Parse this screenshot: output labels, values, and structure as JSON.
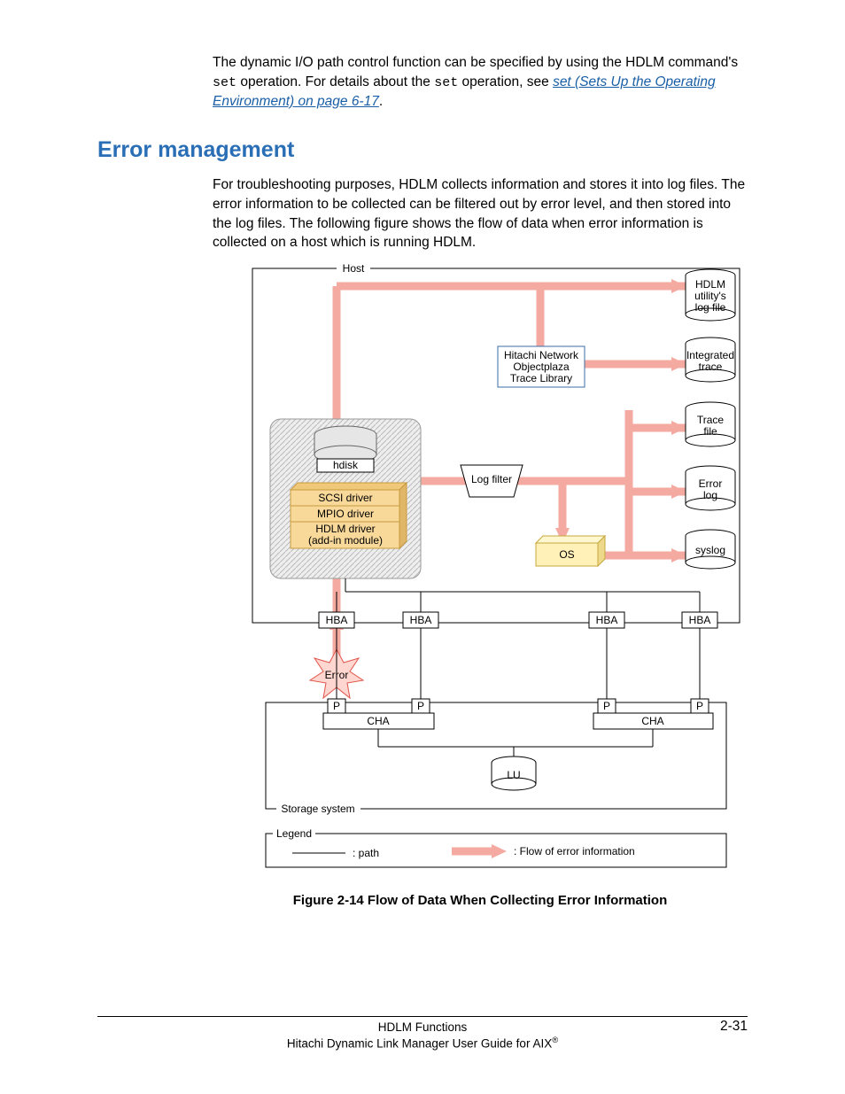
{
  "para1": {
    "t1": "The dynamic I/O path control function can be specified by using the HDLM command's ",
    "code1": "set",
    "t2": " operation. For details about the ",
    "code2": "set",
    "t3": " operation, see ",
    "link": "set (Sets Up the Operating Environment) on page 6-17",
    "t4": "."
  },
  "heading": "Error management",
  "para2": "For troubleshooting purposes, HDLM collects information and stores it into log files. The error information to be collected can be filtered out by error level, and then stored into the log files. The following figure shows the flow of data when error information is collected on a host which is running HDLM.",
  "figure_caption": "Figure 2-14 Flow of Data When Collecting Error Information",
  "footer": {
    "center1": "HDLM Functions",
    "pagenum": "2-31",
    "center2_a": "Hitachi Dynamic Link Manager User Guide for AIX",
    "center2_sup": "®"
  },
  "fig": {
    "host": "Host",
    "hdisk": "hdisk",
    "scsi": "SCSI driver",
    "mpio": "MPIO driver",
    "hdlm_driver1": "HDLM driver",
    "hdlm_driver2": "(add-in module)",
    "logfilter": "Log filter",
    "trace_lib1": "Hitachi Network",
    "trace_lib2": "Objectplaza",
    "trace_lib3": "Trace Library",
    "os": "OS",
    "hba": "HBA",
    "error": "Error",
    "p": "P",
    "cha": "CHA",
    "lu": "LU",
    "storage": "Storage system",
    "legend": "Legend",
    "legend_path": ": path",
    "legend_flow": ": Flow of error information",
    "cyl_util1": "HDLM",
    "cyl_util2": "utility's",
    "cyl_util3": "log file",
    "cyl_int1": "Integrated",
    "cyl_int2": "trace",
    "cyl_trace1": "Trace",
    "cyl_trace2": "file",
    "cyl_errlog1": "Error",
    "cyl_errlog2": "log",
    "cyl_syslog": "syslog"
  }
}
